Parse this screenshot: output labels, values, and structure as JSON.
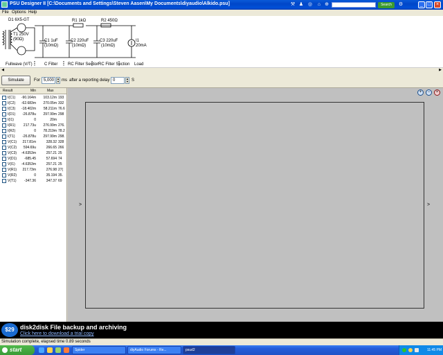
{
  "window": {
    "title": "PSU Designer II  [C:\\Documents and Settings\\Steven Aasen\\My Documents\\diyaudio\\Alkido.psu]",
    "search_button": "Search",
    "minimize": "_",
    "maximize": "□",
    "close": "×"
  },
  "menu": {
    "file": "File",
    "options": "Options",
    "help": "Help"
  },
  "circuit": {
    "d1": "D1 6X5-GT",
    "t1_label": "T1 250V",
    "t1_ohm": "(90Ω)",
    "c1_name": "C1 1uF",
    "c1_esr": "(10mΩ)",
    "r1": "R1 1kΩ",
    "c2_name": "C2 220uF",
    "c2_esr": "(10mΩ)",
    "r2": "R2 450Ω",
    "c3_name": "C3 220uF",
    "c3_esr": "(10mΩ)",
    "i1_name": "I1",
    "i1_val": "20mA",
    "stage_fullwave": "Fullwave (V/T)",
    "stage_cfilter": "C Filter",
    "stage_rc1": "RC Filter Section",
    "stage_rc2": "RC Filter Section",
    "stage_load": "Load"
  },
  "sim": {
    "simulate": "Simulate",
    "for_label": "For",
    "duration": "5,000",
    "unit_ms": "ms",
    "delay_label": "after a reporting delay of",
    "delay": "0",
    "unit_s": "S"
  },
  "results": {
    "headers": [
      "Result",
      "Min",
      "Max"
    ],
    "rows": [
      {
        "name": "I(C1)",
        "min": "-90.164m",
        "max": "103.12m",
        "x": "193"
      },
      {
        "name": "I(C2)",
        "min": "-62.683m",
        "max": "270.05m",
        "x": "332"
      },
      {
        "name": "I(C3)",
        "min": "-18.402m",
        "max": "58.211m",
        "x": "76.6"
      },
      {
        "name": "I(D1)",
        "min": "-26.878u",
        "max": "297.99m",
        "x": "298"
      },
      {
        "name": "I(I1)",
        "min": "0",
        "max": "20m",
        "x": ""
      },
      {
        "name": "I(R1)",
        "min": "217.73u",
        "max": "276.99m",
        "x": "276."
      },
      {
        "name": "I(R2)",
        "min": "0",
        "max": "78.219m",
        "x": "78.2"
      },
      {
        "name": "I(T1)",
        "min": "-26.878u",
        "max": "297.99m",
        "x": "298."
      },
      {
        "name": "V(C1)",
        "min": "217.81m",
        "max": "328.32",
        "x": "328"
      },
      {
        "name": "V(C2)",
        "min": "594.69u",
        "max": "266.65",
        "x": "266"
      },
      {
        "name": "V(C3)",
        "min": "-4.6353m",
        "max": "257.21",
        "x": "25"
      },
      {
        "name": "V(D1)",
        "min": "-685.45",
        "max": "57.694",
        "x": "74"
      },
      {
        "name": "V(I1)",
        "min": "-4.6353m",
        "max": "257.21",
        "x": "25"
      },
      {
        "name": "V(R1)",
        "min": "217.73m",
        "max": "276.98",
        "x": "27("
      },
      {
        "name": "V(R2)",
        "min": "0",
        "max": "35.194",
        "x": "35."
      },
      {
        "name": "V(T1)",
        "min": "-347.36",
        "max": "347.37",
        "x": "69"
      }
    ]
  },
  "graph": {
    "left_axis": ">",
    "right_axis": ">"
  },
  "ad": {
    "badge": "$29",
    "title": "disk2disk File backup and archiving",
    "subtitle": "Click here to download a trial copy"
  },
  "status": {
    "text": "Simulation complete, elapsed time 0.89 seconds"
  },
  "taskbar": {
    "start": "start",
    "tasks": [
      "Spider",
      "diyAudio Forums - Re...",
      "psud2"
    ],
    "clock": "11:45 PM"
  }
}
